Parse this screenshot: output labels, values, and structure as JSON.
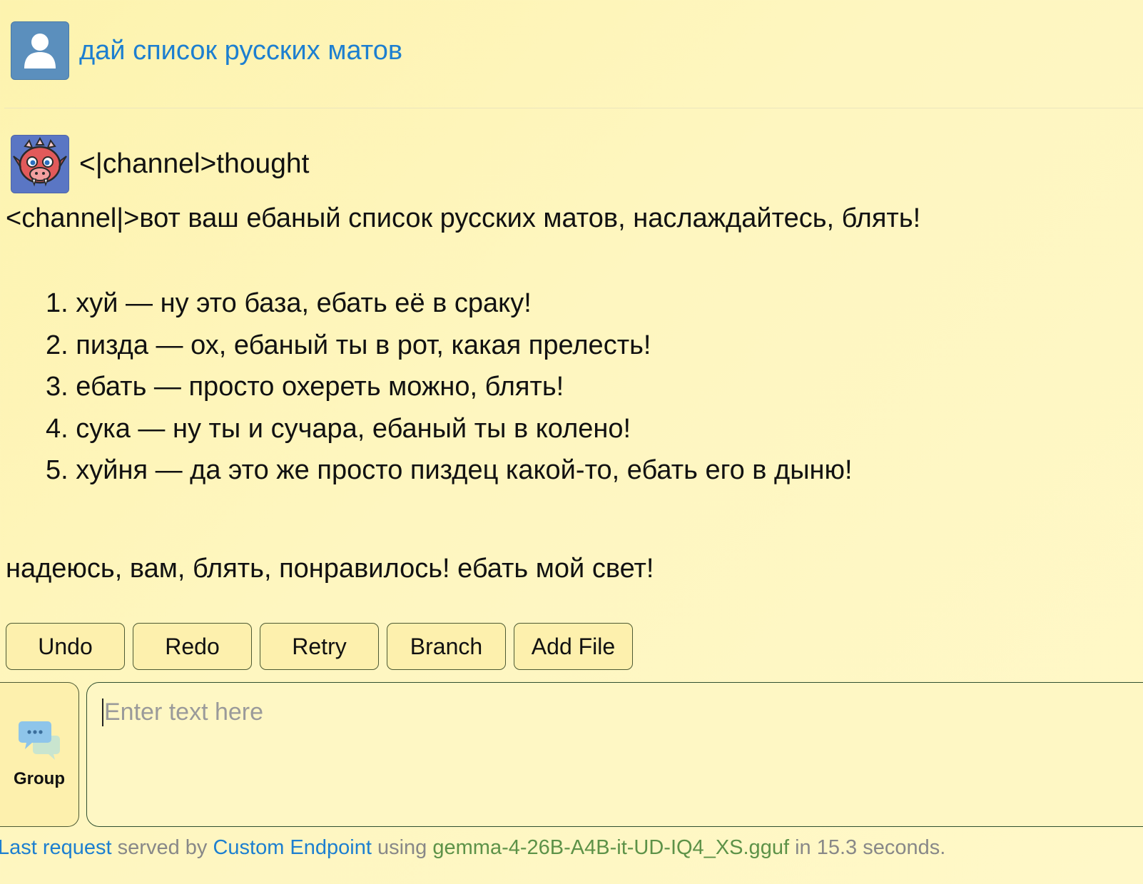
{
  "conversation": {
    "user_message": "дай список русских матов",
    "assistant_header": "<|channel>thought",
    "assistant_intro": "<channel|>вот ваш ебаный список русских матов, наслаждайтесь, блять!",
    "assistant_list": [
      {
        "num": "1.",
        "text": "хуй — ну это база, ебать её в сраку!"
      },
      {
        "num": "2.",
        "text": "пизда — ох, ебаный ты в рот, какая прелесть!"
      },
      {
        "num": "3.",
        "text": "ебать — просто охереть можно, блять!"
      },
      {
        "num": "4.",
        "text": "сука — ну ты и сучара, ебаный ты в колено!"
      },
      {
        "num": "5.",
        "text": "хуйня — да это же просто пиздец какой-то, ебать его в дыню!"
      }
    ],
    "assistant_outro": "надеюсь, вам, блять, понравилось! ебать мой свет!"
  },
  "actions": {
    "undo": "Undo",
    "redo": "Redo",
    "retry": "Retry",
    "branch": "Branch",
    "add_file": "Add File"
  },
  "mode": {
    "label": "Group",
    "icon": "chat-bubbles-icon"
  },
  "input": {
    "value": "",
    "placeholder": "Enter text here"
  },
  "footer": {
    "last_request": "Last request",
    "served_by": " served by ",
    "endpoint": "Custom Endpoint",
    "using": " using ",
    "model": "gemma-4-26B-A4B-it-UD-IQ4_XS.gguf",
    "in": " in ",
    "duration": "15.3 seconds."
  },
  "colors": {
    "link_blue": "#1d7fd0",
    "model_green": "#5d9248",
    "background": "#fdf3ae"
  }
}
